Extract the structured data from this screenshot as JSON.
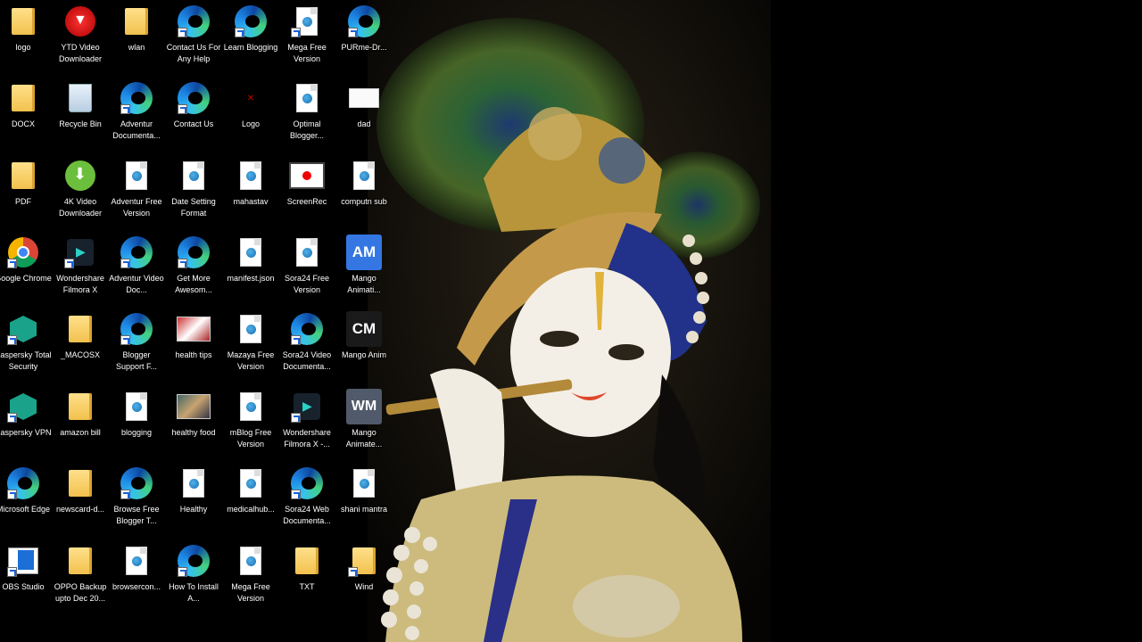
{
  "desktop": {
    "icons": [
      {
        "label": "logo",
        "glyph": "folder-icon",
        "style": "g-folder",
        "shortcut": false
      },
      {
        "label": "YTD Video Downloader",
        "glyph": "ytd-icon",
        "style": "g-ytd",
        "shortcut": false
      },
      {
        "label": "wlan",
        "glyph": "folder-icon",
        "style": "g-folder",
        "shortcut": false
      },
      {
        "label": "Contact Us For Any Help",
        "glyph": "edge-icon",
        "style": "g-edge",
        "shortcut": true
      },
      {
        "label": "Learn Blogging",
        "glyph": "edge-icon",
        "style": "g-edge",
        "shortcut": true
      },
      {
        "label": "Mega Free Version",
        "glyph": "file-icon",
        "style": "g-file",
        "shortcut": true
      },
      {
        "label": "PURme-Dr...",
        "glyph": "edge-icon",
        "style": "g-edge",
        "shortcut": true
      },
      {
        "label": "DOCX",
        "glyph": "folder-icon",
        "style": "g-folder",
        "shortcut": false
      },
      {
        "label": "Recycle Bin",
        "glyph": "recycle-bin-icon",
        "style": "g-recycle",
        "shortcut": false
      },
      {
        "label": "Adventur Documenta...",
        "glyph": "edge-icon",
        "style": "g-edge",
        "shortcut": true
      },
      {
        "label": "Contact Us",
        "glyph": "edge-icon",
        "style": "g-edge",
        "shortcut": true
      },
      {
        "label": "Logo",
        "glyph": "logo-icon",
        "style": "g-logo",
        "shortcut": false
      },
      {
        "label": "Optimal Blogger...",
        "glyph": "file-icon",
        "style": "g-file",
        "shortcut": false
      },
      {
        "label": "dad",
        "glyph": "white-icon",
        "style": "g-white",
        "shortcut": false
      },
      {
        "label": "PDF",
        "glyph": "folder-icon",
        "style": "g-folder",
        "shortcut": false
      },
      {
        "label": "4K Video Downloader",
        "glyph": "4k-downloader-icon",
        "style": "g-4k",
        "shortcut": false
      },
      {
        "label": "Adventur Free Version",
        "glyph": "file-icon",
        "style": "g-file",
        "shortcut": false
      },
      {
        "label": "Date Setting Format",
        "glyph": "file-icon",
        "style": "g-file",
        "shortcut": false
      },
      {
        "label": "mahastav",
        "glyph": "file-icon",
        "style": "g-file",
        "shortcut": false
      },
      {
        "label": "ScreenRec",
        "glyph": "screenrec-icon",
        "style": "g-screen",
        "shortcut": false
      },
      {
        "label": "computn sub",
        "glyph": "file-icon",
        "style": "g-file",
        "shortcut": false
      },
      {
        "label": "Google Chrome",
        "glyph": "chrome-icon",
        "style": "g-chrome",
        "shortcut": true
      },
      {
        "label": "Wondershare Filmora X",
        "glyph": "filmora-icon",
        "style": "g-filmora",
        "shortcut": true
      },
      {
        "label": "Adventur Video Doc...",
        "glyph": "edge-icon",
        "style": "g-edge",
        "shortcut": true
      },
      {
        "label": "Get More Awesom...",
        "glyph": "edge-icon",
        "style": "g-edge",
        "shortcut": true
      },
      {
        "label": "manifest.json",
        "glyph": "file-icon",
        "style": "g-file",
        "shortcut": false
      },
      {
        "label": "Sora24 Free Version",
        "glyph": "file-icon",
        "style": "g-file",
        "shortcut": false
      },
      {
        "label": "Mango Animati...",
        "glyph": "am-icon",
        "style": "g-am",
        "shortcut": false
      },
      {
        "label": "Kaspersky Total Security",
        "glyph": "kaspersky-icon",
        "style": "g-kasp",
        "shortcut": true
      },
      {
        "label": "_MACOSX",
        "glyph": "folder-icon",
        "style": "g-folder",
        "shortcut": false
      },
      {
        "label": "Blogger Support F...",
        "glyph": "edge-icon",
        "style": "g-edge",
        "shortcut": true
      },
      {
        "label": "health tips",
        "glyph": "image-icon",
        "style": "g-photo",
        "shortcut": false
      },
      {
        "label": "Mazaya Free Version",
        "glyph": "file-icon",
        "style": "g-file",
        "shortcut": false
      },
      {
        "label": "Sora24 Video Documenta...",
        "glyph": "edge-icon",
        "style": "g-edge",
        "shortcut": true
      },
      {
        "label": "Mango Anim",
        "glyph": "cm-icon",
        "style": "g-cm",
        "shortcut": false
      },
      {
        "label": "Kaspersky VPN",
        "glyph": "kaspersky-icon",
        "style": "g-kasp",
        "shortcut": true
      },
      {
        "label": "amazon bill",
        "glyph": "folder-icon",
        "style": "g-folder",
        "shortcut": false
      },
      {
        "label": "blogging",
        "glyph": "file-icon",
        "style": "g-file",
        "shortcut": false
      },
      {
        "label": "healthy food",
        "glyph": "image-icon",
        "style": "g-photo2",
        "shortcut": false
      },
      {
        "label": "mBlog Free Version",
        "glyph": "file-icon",
        "style": "g-file",
        "shortcut": false
      },
      {
        "label": "Wondershare Filmora X -...",
        "glyph": "filmora-icon",
        "style": "g-filmora",
        "shortcut": true
      },
      {
        "label": "Mango Animate...",
        "glyph": "wm-icon",
        "style": "g-wm",
        "shortcut": false
      },
      {
        "label": "Microsoft Edge",
        "glyph": "edge-icon",
        "style": "g-edge",
        "shortcut": true
      },
      {
        "label": "newscard-d...",
        "glyph": "folder-icon",
        "style": "g-folder",
        "shortcut": false
      },
      {
        "label": "Browse Free Blogger T...",
        "glyph": "edge-icon",
        "style": "g-edge",
        "shortcut": true
      },
      {
        "label": "Healthy",
        "glyph": "file-icon",
        "style": "g-file",
        "shortcut": false
      },
      {
        "label": "medicalhub...",
        "glyph": "file-icon",
        "style": "g-file",
        "shortcut": false
      },
      {
        "label": "Sora24 Web Documenta...",
        "glyph": "edge-icon",
        "style": "g-edge",
        "shortcut": true
      },
      {
        "label": "shani mantra",
        "glyph": "file-icon",
        "style": "g-file",
        "shortcut": false
      },
      {
        "label": "OBS Studio",
        "glyph": "obs-icon",
        "style": "g-obs",
        "shortcut": true
      },
      {
        "label": "OPPO Backup upto Dec 20...",
        "glyph": "folder-icon",
        "style": "g-folder",
        "shortcut": false
      },
      {
        "label": "browsercon...",
        "glyph": "file-icon",
        "style": "g-file",
        "shortcut": false
      },
      {
        "label": "How To Install A...",
        "glyph": "edge-icon",
        "style": "g-edge",
        "shortcut": true
      },
      {
        "label": "Mega Free Version",
        "glyph": "file-icon",
        "style": "g-file",
        "shortcut": false
      },
      {
        "label": "TXT",
        "glyph": "folder-icon",
        "style": "g-folder",
        "shortcut": false
      },
      {
        "label": "Wind",
        "glyph": "folder-icon",
        "style": "g-folder",
        "shortcut": true
      }
    ]
  },
  "colors": {
    "background": "#000000",
    "label_text": "#ffffff",
    "shortcut_arrow": "#1c62d8"
  }
}
